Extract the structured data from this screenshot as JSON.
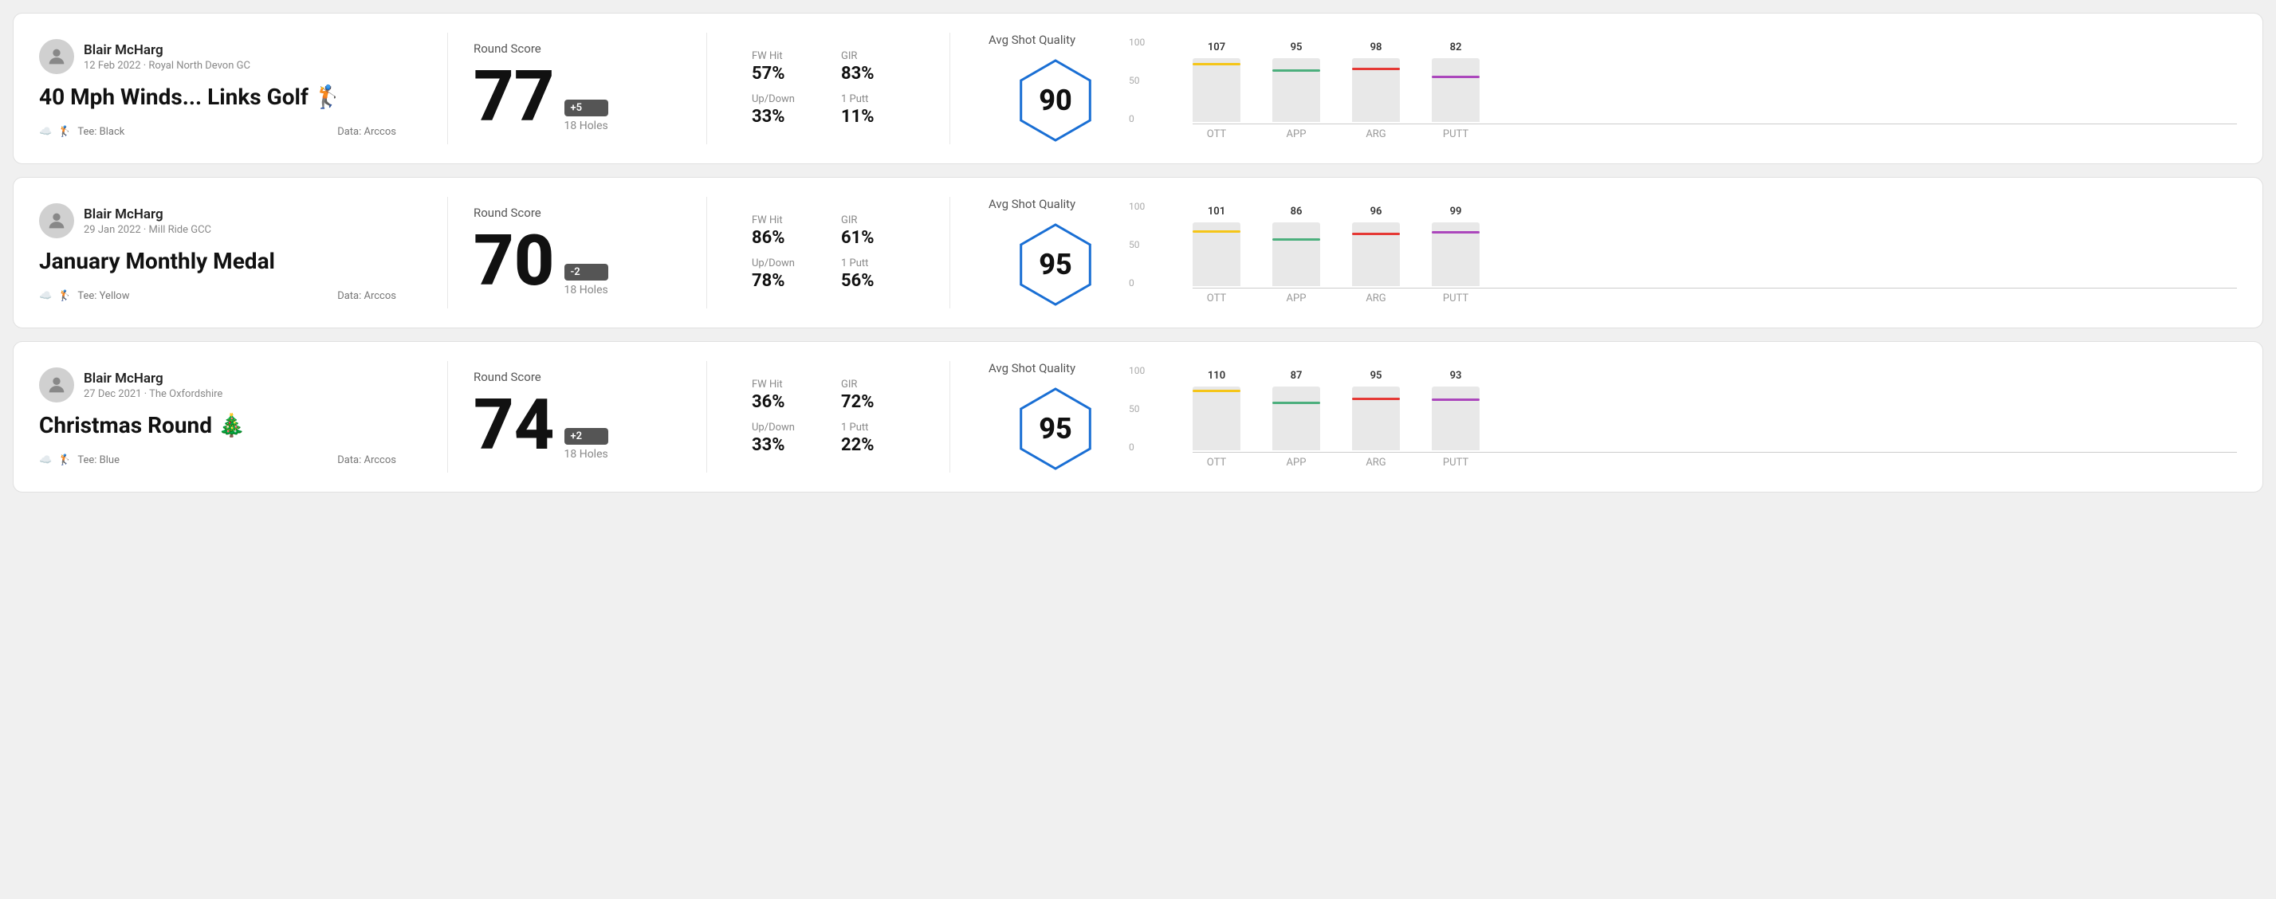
{
  "rounds": [
    {
      "id": "round-1",
      "user": {
        "name": "Blair McHarg",
        "date": "12 Feb 2022",
        "course": "Royal North Devon GC"
      },
      "title": "40 Mph Winds... Links Golf 🏌️",
      "tee": "Black",
      "data_source": "Data: Arccos",
      "score": {
        "label": "Round Score",
        "number": "77",
        "modifier": "+5",
        "holes": "18 Holes"
      },
      "stats": {
        "fw_hit_label": "FW Hit",
        "fw_hit_value": "57%",
        "gir_label": "GIR",
        "gir_value": "83%",
        "updown_label": "Up/Down",
        "updown_value": "33%",
        "one_putt_label": "1 Putt",
        "one_putt_value": "11%"
      },
      "quality": {
        "label": "Avg Shot Quality",
        "score": "90"
      },
      "chart": {
        "bars": [
          {
            "label": "OTT",
            "value": 107,
            "color": "#f5c518",
            "max": 120
          },
          {
            "label": "APP",
            "value": 95,
            "color": "#4caf7d",
            "max": 120
          },
          {
            "label": "ARG",
            "value": 98,
            "color": "#e53935",
            "max": 120
          },
          {
            "label": "PUTT",
            "value": 82,
            "color": "#ab47bc",
            "max": 120
          }
        ]
      }
    },
    {
      "id": "round-2",
      "user": {
        "name": "Blair McHarg",
        "date": "29 Jan 2022",
        "course": "Mill Ride GCC"
      },
      "title": "January Monthly Medal",
      "tee": "Yellow",
      "data_source": "Data: Arccos",
      "score": {
        "label": "Round Score",
        "number": "70",
        "modifier": "-2",
        "holes": "18 Holes"
      },
      "stats": {
        "fw_hit_label": "FW Hit",
        "fw_hit_value": "86%",
        "gir_label": "GIR",
        "gir_value": "61%",
        "updown_label": "Up/Down",
        "updown_value": "78%",
        "one_putt_label": "1 Putt",
        "one_putt_value": "56%"
      },
      "quality": {
        "label": "Avg Shot Quality",
        "score": "95"
      },
      "chart": {
        "bars": [
          {
            "label": "OTT",
            "value": 101,
            "color": "#f5c518",
            "max": 120
          },
          {
            "label": "APP",
            "value": 86,
            "color": "#4caf7d",
            "max": 120
          },
          {
            "label": "ARG",
            "value": 96,
            "color": "#e53935",
            "max": 120
          },
          {
            "label": "PUTT",
            "value": 99,
            "color": "#ab47bc",
            "max": 120
          }
        ]
      }
    },
    {
      "id": "round-3",
      "user": {
        "name": "Blair McHarg",
        "date": "27 Dec 2021",
        "course": "The Oxfordshire"
      },
      "title": "Christmas Round 🎄",
      "tee": "Blue",
      "data_source": "Data: Arccos",
      "score": {
        "label": "Round Score",
        "number": "74",
        "modifier": "+2",
        "holes": "18 Holes"
      },
      "stats": {
        "fw_hit_label": "FW Hit",
        "fw_hit_value": "36%",
        "gir_label": "GIR",
        "gir_value": "72%",
        "updown_label": "Up/Down",
        "updown_value": "33%",
        "one_putt_label": "1 Putt",
        "one_putt_value": "22%"
      },
      "quality": {
        "label": "Avg Shot Quality",
        "score": "95"
      },
      "chart": {
        "bars": [
          {
            "label": "OTT",
            "value": 110,
            "color": "#f5c518",
            "max": 120
          },
          {
            "label": "APP",
            "value": 87,
            "color": "#4caf7d",
            "max": 120
          },
          {
            "label": "ARG",
            "value": 95,
            "color": "#e53935",
            "max": 120
          },
          {
            "label": "PUTT",
            "value": 93,
            "color": "#ab47bc",
            "max": 120
          }
        ]
      }
    }
  ],
  "chart_y_labels": [
    "100",
    "50",
    "0"
  ]
}
